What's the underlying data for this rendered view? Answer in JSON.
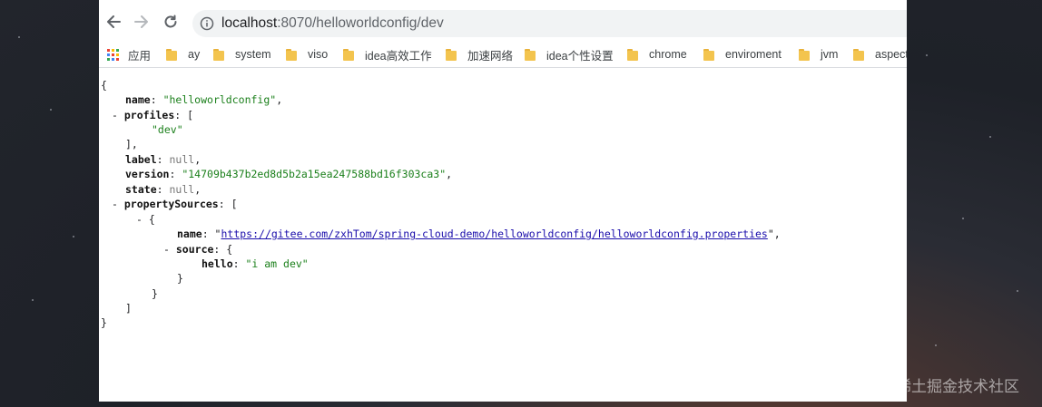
{
  "browser": {
    "address_bar": {
      "protocol_icon": "info-icon",
      "url_host": "localhost",
      "url_rest": ":8070/helloworldconfig/dev"
    },
    "nav_icons": [
      "back-arrow-icon",
      "forward-arrow-icon",
      "reload-icon"
    ],
    "bookmarks": [
      {
        "label": "应用",
        "icon": "apps-grid-icon"
      },
      {
        "label": "ay",
        "icon": "folder-icon"
      },
      {
        "label": "system",
        "icon": "folder-icon"
      },
      {
        "label": "viso",
        "icon": "folder-icon"
      },
      {
        "label": "idea高效工作",
        "icon": "folder-icon"
      },
      {
        "label": "加速网络",
        "icon": "folder-icon"
      },
      {
        "label": "idea个性设置",
        "icon": "folder-icon"
      },
      {
        "label": "chrome",
        "icon": "folder-icon"
      },
      {
        "label": "enviroment",
        "icon": "folder-icon"
      },
      {
        "label": "jvm",
        "icon": "folder-icon"
      },
      {
        "label": "aspect",
        "icon": "folder-icon"
      }
    ]
  },
  "json": {
    "open_brace": "{",
    "close_brace": "}",
    "name_key": "name",
    "name_value": "\"helloworldconfig\"",
    "profiles_key": "profiles",
    "profiles_values": [
      "\"dev\""
    ],
    "label_key": "label",
    "label_value": "null",
    "version_key": "version",
    "version_value": "\"14709b437b2ed8d5b2a15ea247588bd16f303ca3\"",
    "state_key": "state",
    "state_value": "null",
    "property_sources_key": "propertySources",
    "ps_name_key": "name",
    "ps_name_value": "https://gitee.com/zxhTom/spring-cloud-demo/helloworldconfig/helloworldconfig.properties",
    "source_key": "source",
    "hello_key": "hello",
    "hello_value": "\"i am dev\"",
    "toggle": "-"
  },
  "watermark": "@稀土掘金技术社区",
  "colors": {
    "string": "#1a7f1a",
    "null": "#777777",
    "link": "#1a0dab",
    "folder": "#f3c44e"
  }
}
